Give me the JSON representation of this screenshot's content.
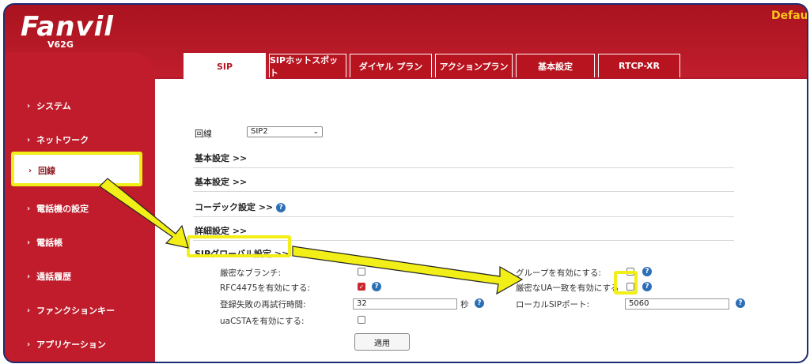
{
  "brand": {
    "logo": "Fanvil",
    "model": "V62G"
  },
  "header": {
    "user_label": "Defau"
  },
  "tabs": [
    {
      "label": "SIP",
      "active": true
    },
    {
      "label": "SIPホットスポット"
    },
    {
      "label": "ダイヤル プラン"
    },
    {
      "label": "アクションプラン"
    },
    {
      "label": "基本設定"
    },
    {
      "label": "RTCP-XR"
    }
  ],
  "sidebar": {
    "items": [
      {
        "label": "システム"
      },
      {
        "label": "ネットワーク"
      },
      {
        "label": "回線",
        "active": true
      },
      {
        "label": "電話機の設定"
      },
      {
        "label": "電話帳"
      },
      {
        "label": "通話履歴"
      },
      {
        "label": "ファンクションキー"
      },
      {
        "label": "アプリケーション"
      }
    ]
  },
  "main": {
    "line_label": "回線",
    "line_select": "SIP2",
    "sections": [
      {
        "label": "基本設定 >>"
      },
      {
        "label": "基本設定 >>"
      },
      {
        "label": "コーデック設定 >>"
      },
      {
        "label": "詳細設定 >>"
      },
      {
        "label": "SIPグローバル設定 >>"
      }
    ],
    "settings": {
      "strict_branch": {
        "label": "厳密なブランチ:",
        "checked": false
      },
      "group_enable": {
        "label": "グループを有効にする:",
        "checked": false
      },
      "rfc4475": {
        "label": "RFC4475を有効にする:",
        "checked": true
      },
      "strict_ua": {
        "label": "厳密なUA一致を有効にする",
        "checked": false
      },
      "reg_retry": {
        "label": "登録失敗の再試行時間:",
        "value": "32",
        "unit": "秒"
      },
      "local_sip_port": {
        "label": "ローカルSIPポート:",
        "value": "5060"
      },
      "uacsta": {
        "label": "uaCSTAを有効にする:",
        "checked": false
      }
    },
    "apply_label": "適用"
  },
  "colors": {
    "brand_red": "#c01c2b",
    "highlight": "#f2ee17",
    "help_blue": "#2c6fb7"
  },
  "icons": {
    "help": "help-circle-icon",
    "chevron": "chevron-right-icon",
    "dropdown": "chevron-down-icon"
  }
}
